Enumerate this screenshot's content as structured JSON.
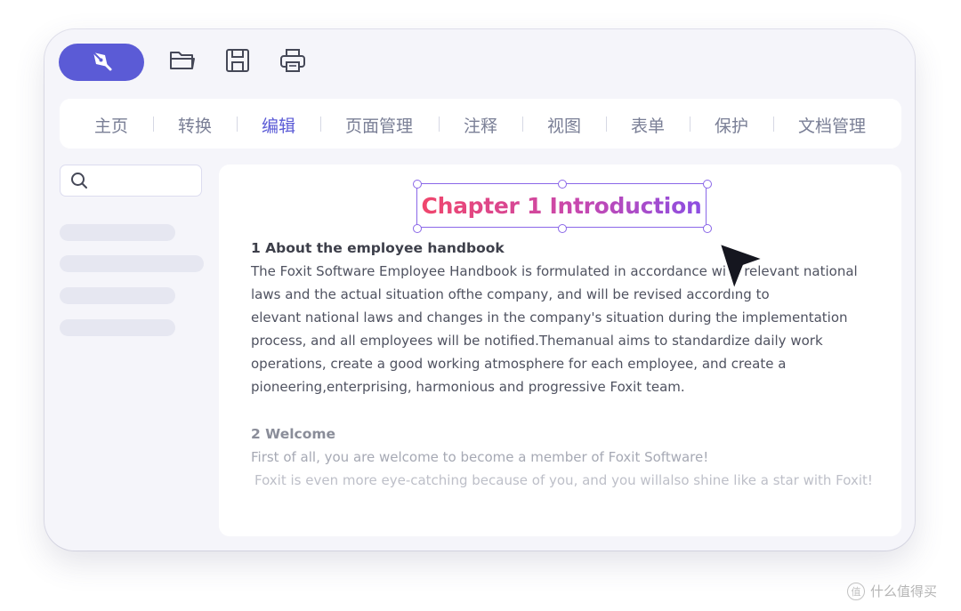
{
  "toolbar": {
    "pen_icon": "pen-nib-icon",
    "open_icon": "folder-open-icon",
    "save_icon": "save-icon",
    "print_icon": "printer-icon"
  },
  "tabs": [
    {
      "label": "主页",
      "active": false
    },
    {
      "label": "转换",
      "active": false
    },
    {
      "label": "编辑",
      "active": true
    },
    {
      "label": "页面管理",
      "active": false
    },
    {
      "label": "注释",
      "active": false
    },
    {
      "label": "视图",
      "active": false
    },
    {
      "label": "表单",
      "active": false
    },
    {
      "label": "保护",
      "active": false
    },
    {
      "label": "文档管理",
      "active": false
    }
  ],
  "search": {
    "placeholder": "",
    "value": ""
  },
  "document": {
    "title": "Chapter 1 Introduction",
    "section1": {
      "heading": "1 About the employee handbook",
      "lines": [
        "The Foxit Software Employee Handbook is formulated in accordance with relevant national",
        "laws and the actual situation ofthe company, and will be revised according to",
        "elevant national laws and changes in the company's situation during the implementation",
        "process, and all employees will be notified.Themanual aims to standardize daily work",
        "operations, create a good working atmosphere for each employee, and create a",
        "pioneering,enterprising, harmonious and progressive Foxit team."
      ]
    },
    "section2": {
      "heading": "2 Welcome",
      "lines": [
        "First of all, you are welcome to become a member of Foxit Software!",
        "Foxit is even more eye-catching because of you, and you willalso shine like a star with Foxit!"
      ]
    }
  },
  "colors": {
    "accent": "#5b5bd6",
    "title_gradient_start": "#f1466a",
    "title_gradient_end": "#8a4fe4",
    "selection": "#8a67e8"
  },
  "watermark": {
    "text": "什么值得买",
    "icon": "watermark-logo-icon"
  }
}
